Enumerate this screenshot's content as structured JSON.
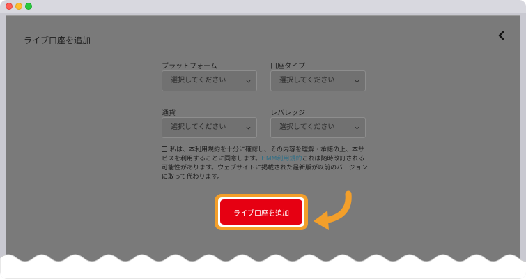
{
  "page": {
    "title": "ライブ口座を追加"
  },
  "form": {
    "platform": {
      "label": "プラットフォーム",
      "placeholder": "選択してください"
    },
    "account_type": {
      "label": "口座タイプ",
      "placeholder": "選択してください"
    },
    "currency": {
      "label": "通貨",
      "placeholder": "選択してください"
    },
    "leverage": {
      "label": "レバレッジ",
      "placeholder": "選択してください"
    }
  },
  "terms": {
    "text_before": "私は、本利用規約を十分に確認し、その内容を理解・承諾の上、本サービスを利用することに同意します。",
    "link": "HMM利用規約",
    "text_after": "これは随時改訂される可能性があります。ウェブサイトに掲載された最新版が以前のバージョンに取って代わります。"
  },
  "submit": {
    "label": "ライブ口座を追加"
  },
  "colors": {
    "accent": "#e60012",
    "highlight": "#f39f2a",
    "link": "#2f6f86"
  },
  "icons": {
    "close": "chevron-left-icon",
    "select": "chevron-down-icon",
    "pointer": "curved-arrow-icon"
  }
}
